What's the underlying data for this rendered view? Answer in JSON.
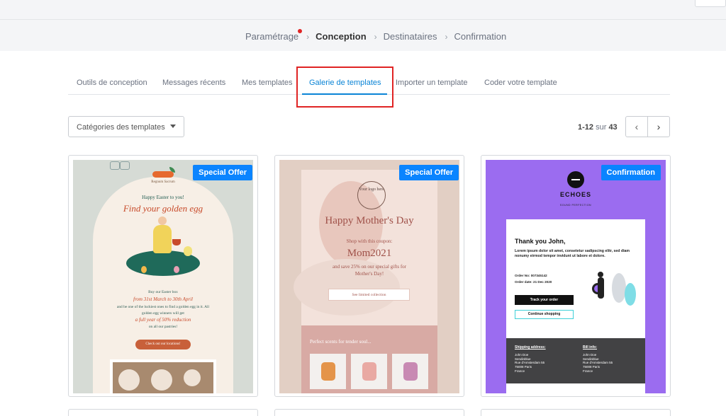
{
  "steps": [
    {
      "label": "Paramétrage",
      "notification": true
    },
    {
      "label": "Conception",
      "active": true
    },
    {
      "label": "Destinataires"
    },
    {
      "label": "Confirmation"
    }
  ],
  "tabs": [
    {
      "label": "Outils de conception"
    },
    {
      "label": "Messages récents"
    },
    {
      "label": "Mes templates"
    },
    {
      "label": "Galerie de templates",
      "active": true
    },
    {
      "label": "Importer un template"
    },
    {
      "label": "Coder votre template"
    }
  ],
  "filter": {
    "label": "Catégories des templates",
    "icon": "chevron-down-icon"
  },
  "pagination": {
    "range": "1-12",
    "of": "sur",
    "total": "43",
    "prev_icon": "chevron-left-icon",
    "next_icon": "chevron-right-icon"
  },
  "colors": {
    "accent": "#0a84ff",
    "highlight": "#e02424"
  },
  "cards": [
    {
      "badge": "Special Offer",
      "template": {
        "brand": "Regnum Sacrum",
        "greeting": "Happy Easter to you!",
        "headline": "Find your golden egg",
        "line1": "Buy our Easter box",
        "line2": "from 31st March to 30th April",
        "line3": "and be one of the luckiest ones to find a golden egg in it. All",
        "line4": "golden egg winners will get",
        "line5": "a full year of 50% reduction",
        "line6": "on all our pastries!",
        "cta": "Check out our locations!"
      }
    },
    {
      "badge": "Special Offer",
      "template": {
        "logo": "Your logo here",
        "title": "Happy Mother's Day",
        "coupon_intro": "Shop with this coupon:",
        "code": "Mom2021",
        "save_text": "and save 25% on our special gifts for",
        "save_text2": "Mother's Day!",
        "button": "See limited collection",
        "section_title": "Perfect scents for tender soul..."
      }
    },
    {
      "badge": "Confirmation",
      "template": {
        "brand": "ECHOES",
        "tagline": "SOUND PERFECTION",
        "greeting": "Thank you John,",
        "lorem": "Lorem ipsum dolor sit amet, consetetur sadipscing elitr, sed diam nonumy eirmod tempor invidunt ut labore et dolore.",
        "order_no": "Order No: 007345142",
        "order_date": "Order date: 21 Dec 2020",
        "track": "Track your order",
        "continue": "Continue shopping",
        "shipping_label": "Shipping address:",
        "shipping": "John Doe\nSendinblue\nRue d'Amsterdam 55\n75008 Paris\nFrance",
        "billing_label": "Bill info:",
        "billing": "John Doe\nSendinblue\nRue d'Amsterdam 55\n75008 Paris\nFrance"
      }
    }
  ]
}
